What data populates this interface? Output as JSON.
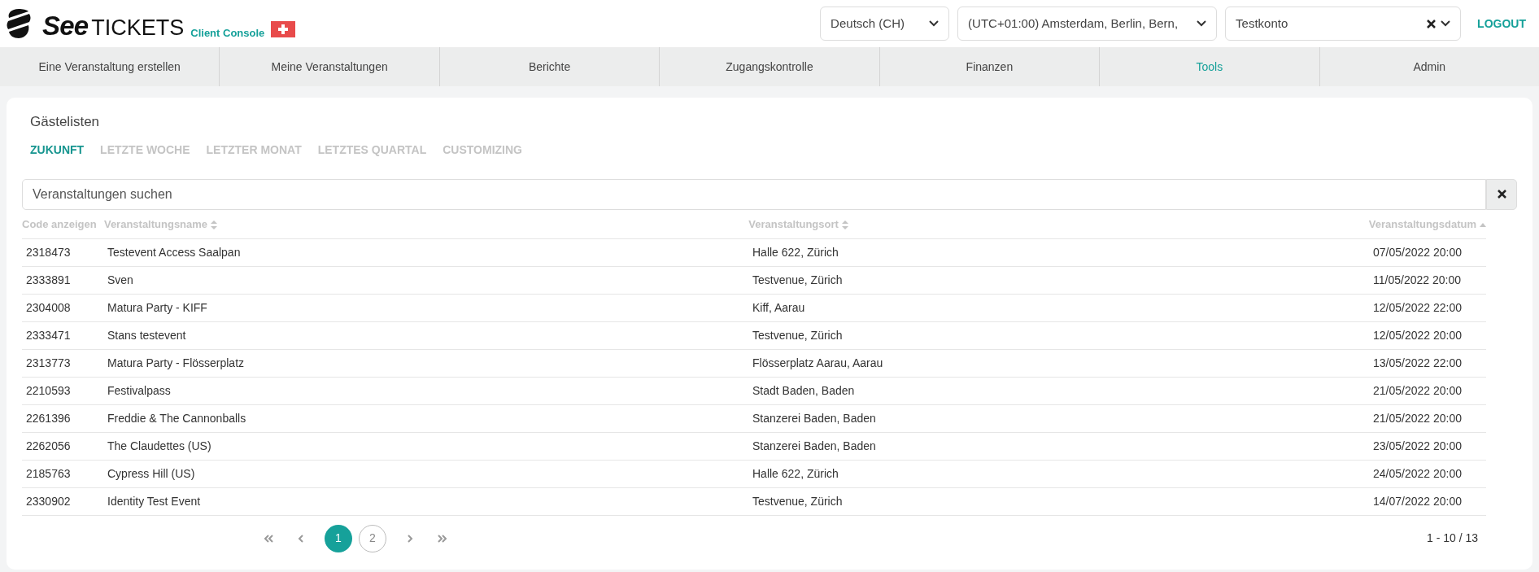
{
  "header": {
    "logo": {
      "brand_bold": "See",
      "brand_light": "TICKETS",
      "subtitle": "Client Console"
    },
    "language_select": {
      "value": "Deutsch (CH)"
    },
    "timezone_select": {
      "value": "(UTC+01:00) Amsterdam, Berlin, Bern,"
    },
    "account_select": {
      "value": "Testkonto"
    },
    "logout": "LOGOUT"
  },
  "nav": [
    {
      "label": "Eine Veranstaltung erstellen",
      "selected": false
    },
    {
      "label": "Meine Veranstaltungen",
      "selected": false
    },
    {
      "label": "Berichte",
      "selected": false
    },
    {
      "label": "Zugangskontrolle",
      "selected": false
    },
    {
      "label": "Finanzen",
      "selected": false
    },
    {
      "label": "Tools",
      "selected": true
    },
    {
      "label": "Admin",
      "selected": false
    }
  ],
  "card": {
    "title": "Gästelisten",
    "tabs": [
      {
        "label": "ZUKUNFT",
        "selected": true
      },
      {
        "label": "LETZTE WOCHE",
        "selected": false
      },
      {
        "label": "LETZTER MONAT",
        "selected": false
      },
      {
        "label": "LETZTES QUARTAL",
        "selected": false
      },
      {
        "label": "CUSTOMIZING",
        "selected": false
      }
    ],
    "search": {
      "placeholder": "Veranstaltungen suchen"
    },
    "table": {
      "columns": [
        {
          "label": "Code anzeigen",
          "sortable": false
        },
        {
          "label": "Veranstaltungsname",
          "sortable": true,
          "sorted_ascending": false
        },
        {
          "label": "Veranstaltungsort",
          "sortable": true,
          "sorted_ascending": false
        },
        {
          "label": "Veranstaltungsdatum",
          "sortable": true,
          "sorted_ascending": true
        }
      ],
      "rows": [
        [
          "2318473",
          "Testevent Access Saalpan",
          "Halle 622, Zürich",
          "07/05/2022 20:00"
        ],
        [
          "2333891",
          "Sven",
          "Testvenue, Zürich",
          "11/05/2022 20:00"
        ],
        [
          "2304008",
          "Matura Party - KIFF",
          "Kiff, Aarau",
          "12/05/2022 22:00"
        ],
        [
          "2333471",
          "Stans testevent",
          "Testvenue, Zürich",
          "12/05/2022 20:00"
        ],
        [
          "2313773",
          "Matura Party - Flösserplatz",
          "Flösserplatz Aarau, Aarau",
          "13/05/2022 22:00"
        ],
        [
          "2210593",
          "Festivalpass",
          "Stadt Baden, Baden",
          "21/05/2022 20:00"
        ],
        [
          "2261396",
          "Freddie & The Cannonballs",
          "Stanzerei Baden, Baden",
          "21/05/2022 20:00"
        ],
        [
          "2262056",
          "The Claudettes (US)",
          "Stanzerei Baden, Baden",
          "23/05/2022 20:00"
        ],
        [
          "2185763",
          "Cypress Hill (US)",
          "Halle 622, Zürich",
          "24/05/2022 20:00"
        ],
        [
          "2330902",
          "Identity Test Event",
          "Testvenue, Zürich",
          "14/07/2022 20:00"
        ]
      ]
    },
    "pagination": {
      "pages": [
        {
          "label": "1",
          "selected": true
        },
        {
          "label": "2",
          "selected": false
        }
      ],
      "range": "1 - 10 / 13"
    }
  }
}
